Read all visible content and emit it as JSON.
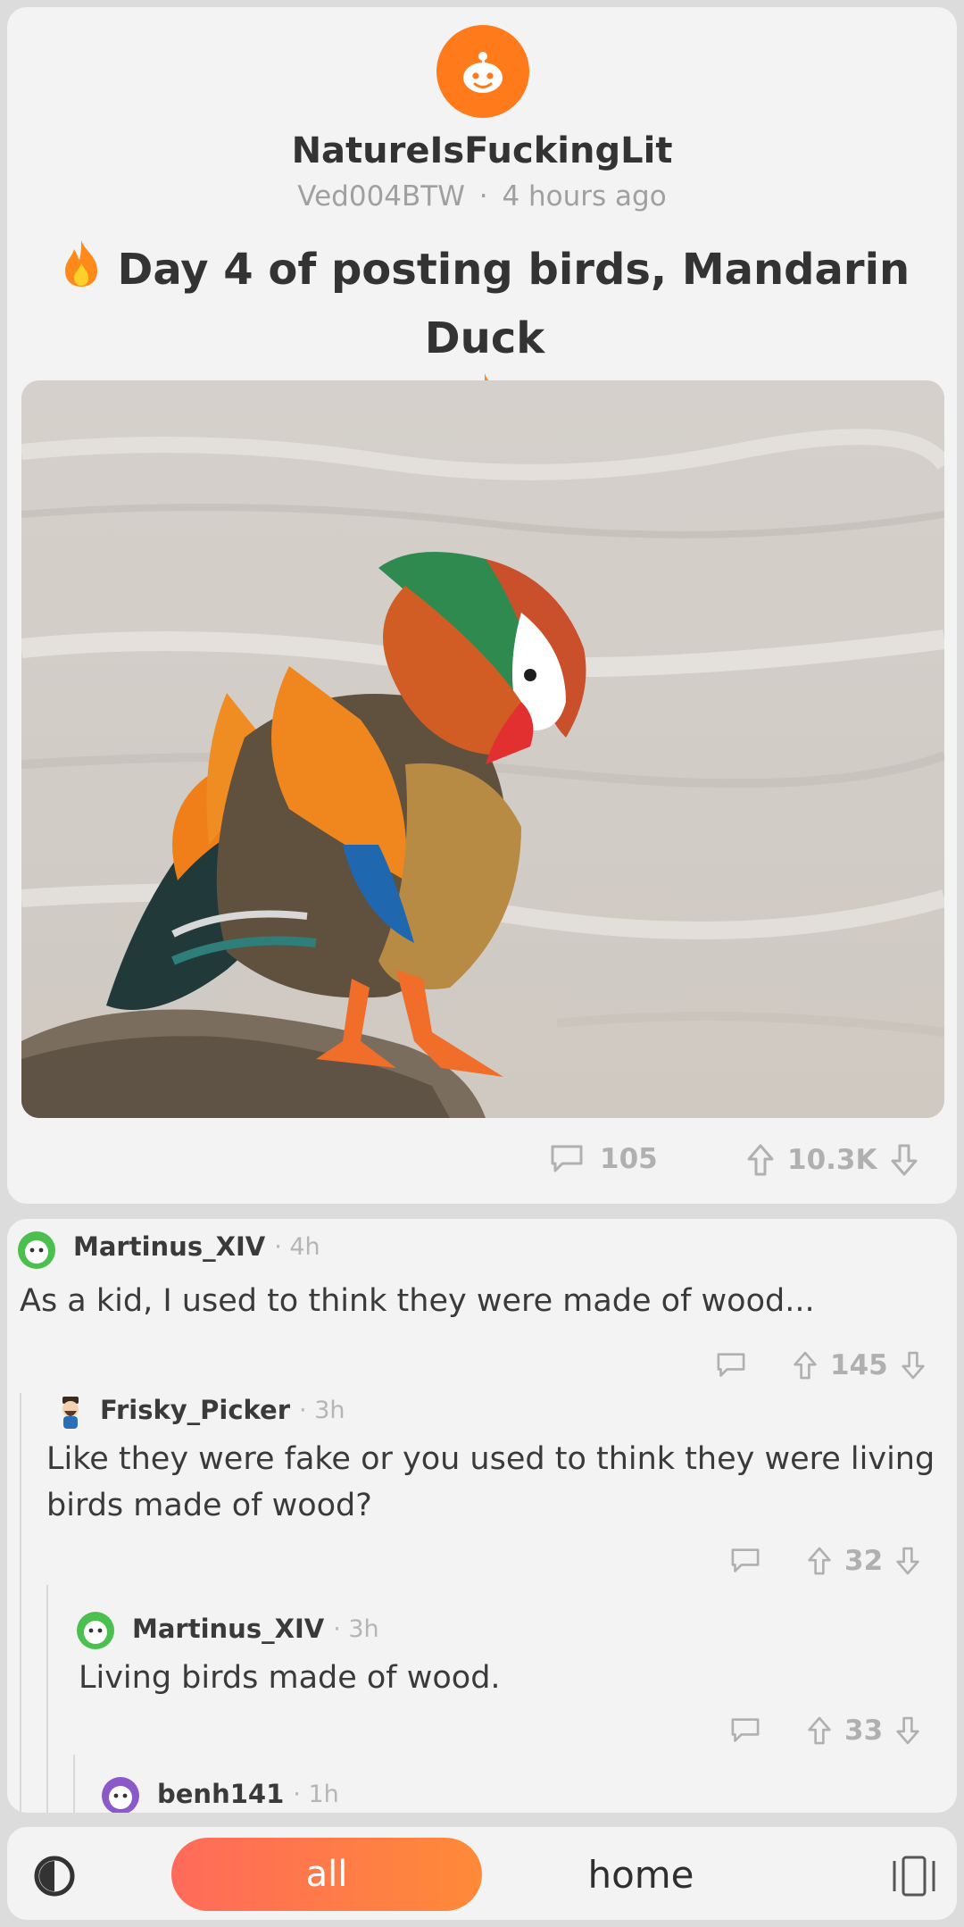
{
  "post": {
    "subreddit": "NatureIsFuckingLit",
    "author": "Ved004BTW",
    "separator": "·",
    "time": "4 hours ago",
    "title_line1": "Day 4 of posting birds, Mandarin Duck",
    "comment_count": "105",
    "score": "10.3K"
  },
  "comments": [
    {
      "author": "Martinus_XIV",
      "time": "4h",
      "text": "As a kid, I used to think they were made of wood...",
      "score": "145"
    },
    {
      "author": "Frisky_Picker",
      "time": "3h",
      "text": "Like they were fake or you used to think they were living birds made of wood?",
      "score": "32"
    },
    {
      "author": "Martinus_XIV",
      "time": "3h",
      "text": "Living birds made of wood.",
      "score": "33"
    },
    {
      "author": "benh141",
      "time": "1h"
    }
  ],
  "nav": {
    "all_label": "all",
    "home_label": "home"
  },
  "colors": {
    "accent": "#ff7a1a",
    "card": "#f3f3f3",
    "muted": "#b0b0b0",
    "thread": "#d8d8d8"
  },
  "icons": [
    "reddit-alien-icon",
    "fire-icon",
    "comment-icon",
    "upvote-icon",
    "downvote-icon",
    "theme-toggle-icon",
    "sidebar-icon"
  ]
}
